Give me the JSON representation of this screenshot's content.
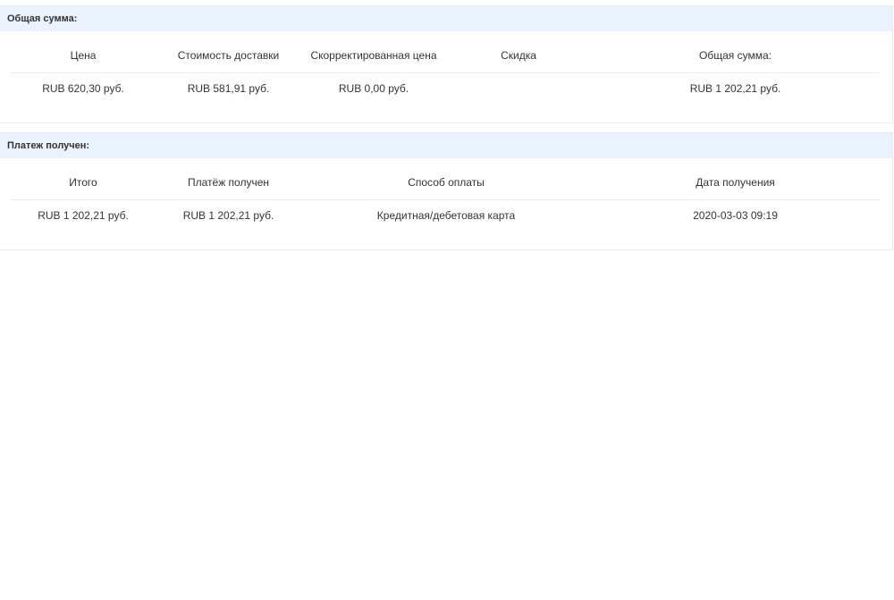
{
  "total_panel": {
    "title": "Общая сумма:",
    "headers": [
      "Цена",
      "Стоимость доставки",
      "Скорректированная цена",
      "Скидка",
      "Общая сумма:"
    ],
    "row": [
      "RUB 620,30 руб.",
      "RUB 581,91 руб.",
      "RUB 0,00 руб.",
      "",
      "RUB 1 202,21 руб."
    ]
  },
  "payment_panel": {
    "title": "Платеж получен:",
    "headers": [
      "Итого",
      "Платёж получен",
      "Способ оплаты",
      "Дата получения"
    ],
    "row": [
      "RUB 1 202,21 руб.",
      "RUB 1 202,21 руб.",
      "Кредитная/дебетовая карта",
      "2020-03-03 09:19"
    ]
  }
}
